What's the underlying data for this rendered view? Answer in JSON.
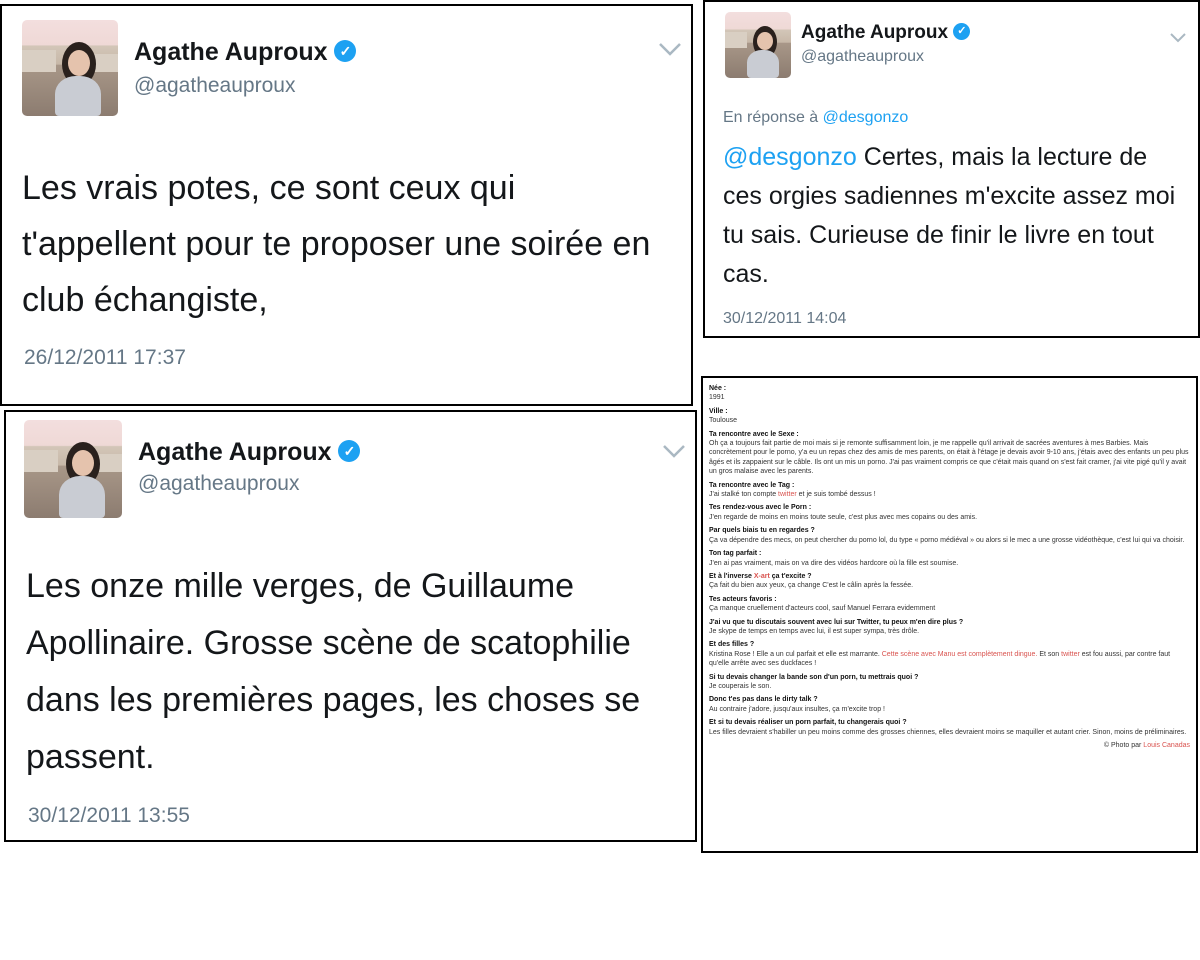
{
  "colors": {
    "verified": "#1da1f2",
    "mention": "#1da1f2",
    "handle_gray": "#657786",
    "link_red": "#d9534f"
  },
  "icons": {
    "verified": "verified-check-icon",
    "menu": "chevron-down-icon"
  },
  "tweet1": {
    "name": "Agathe Auproux",
    "handle": "@agatheauproux",
    "text": "Les vrais potes, ce sont ceux qui t'appellent pour te proposer une soirée en club échangiste,",
    "timestamp": "26/12/2011 17:37"
  },
  "tweet2": {
    "name": "Agathe Auproux",
    "handle": "@agatheauproux",
    "reply_prefix": "En réponse à",
    "reply_to": "@desgonzo",
    "mention": "@desgonzo",
    "text": " Certes, mais la lecture de ces orgies sadiennes m'excite assez moi tu sais. Curieuse de finir le livre en tout cas.",
    "timestamp": "30/12/2011 14:04"
  },
  "tweet3": {
    "name": "Agathe Auproux",
    "handle": "@agatheauproux",
    "text": "Les onze mille verges, de Guillaume Apollinaire. Grosse scène de scatophilie dans les premières pages, les choses se passent.",
    "timestamp": "30/12/2011 13:55"
  },
  "interview": {
    "items": [
      {
        "q": "Née :",
        "a": "1991"
      },
      {
        "q": "Ville :",
        "a": "Toulouse"
      },
      {
        "q": "Ta rencontre avec le Sexe :",
        "a": "Oh ça a toujours fait partie de moi mais si je remonte suffisamment loin, je me rappelle qu'il arrivait de sacrées aventures à mes Barbies. Mais concrètement pour le porno, y'a eu un repas chez des amis de mes parents, on était à l'étage je devais avoir 9-10 ans, j'étais avec des enfants un peu plus âgés et ils zappaient sur le câble. Ils ont un mis un porno. J'ai pas vraiment compris ce que c'était mais quand on s'est fait cramer, j'ai vite pigé qu'il y avait un gros malaise avec les parents."
      },
      {
        "q": "Ta rencontre avec le Tag :",
        "a_pre": "J'ai stalké ton compte ",
        "a_link": "twitter",
        "a_post": " et je suis tombé dessus !"
      },
      {
        "q": "Tes rendez-vous avec le Porn :",
        "a": "J'en regarde de moins en moins toute seule, c'est plus avec mes copains ou des amis."
      },
      {
        "q": "Par quels biais tu en regardes ?",
        "a": "Ça va dépendre des mecs, on peut chercher du porno lol, du type « porno médiéval » ou alors si le mec a une grosse vidéothèque, c'est lui qui va choisir."
      },
      {
        "q": "Ton tag parfait :",
        "a": "J'en ai pas vraiment, mais on va dire des vidéos hardcore où la fille est soumise."
      },
      {
        "q_pre": "Et à l'inverse ",
        "q_link": "X-art",
        "q_post": " ça t'excite ?",
        "a": "Ça fait du bien aux yeux, ça change C'est le câlin après la fessée."
      },
      {
        "q": "Tes acteurs favoris :",
        "a": "Ça manque cruellement d'acteurs cool, sauf Manuel Ferrara evidemment"
      },
      {
        "q": "J'ai vu que tu discutais souvent avec lui sur Twitter, tu peux m'en dire plus ?",
        "a": "Je skype de temps en temps avec lui, il est super sympa, très drôle."
      },
      {
        "q": "Et des filles ?",
        "a_pre": "Kristina Rose ! Elle a un cul parfait et elle est marrante. ",
        "a_link": "Cette scène avec Manu est complètement dingue.",
        "a_mid": " Et son ",
        "a_link2": "twitter",
        "a_post": " est fou aussi, par contre faut qu'elle arrête avec ses duckfaces !"
      },
      {
        "q": "Si tu devais changer la bande son d'un porn, tu mettrais quoi ?",
        "a": "Je couperais le son."
      },
      {
        "q": "Donc t'es pas dans le dirty talk ?",
        "a": "Au contraire j'adore, jusqu'aux insultes, ça m'excite trop !"
      },
      {
        "q": "Et si tu devais réaliser un porn parfait, tu changerais quoi ?",
        "a": "Les filles devraient s'habiller un peu moins comme des grosses chiennes, elles devraient moins se maquiller et autant crier. Sinon, moins de préliminaires."
      }
    ],
    "credit_pre": "© Photo par ",
    "credit_link": "Louis Canadas"
  }
}
